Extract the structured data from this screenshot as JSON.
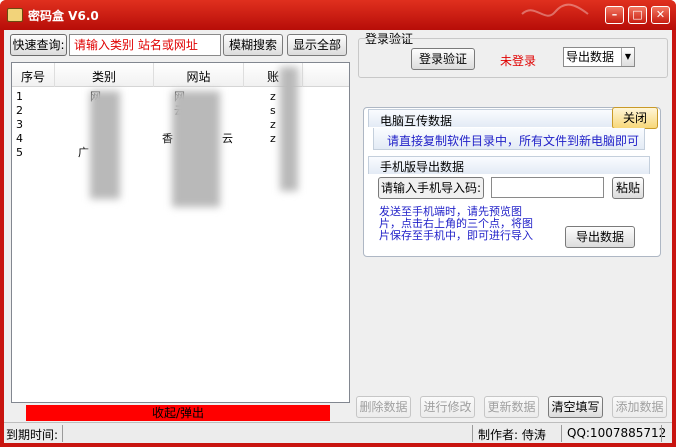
{
  "window": {
    "title": "密码盒 V6.0",
    "min_symbol": "–",
    "max_symbol": "□",
    "close_symbol": "✕"
  },
  "search": {
    "label": "快速查询:",
    "placeholder": "请输入类别 站名或网址",
    "fuzzy_button": "模糊搜索",
    "show_all_button": "显示全部"
  },
  "table": {
    "columns": [
      "序号",
      "类别",
      "网站",
      "账"
    ],
    "rows": [
      {
        "no": "1",
        "cat": "网",
        "site": "网",
        "acc": "z"
      },
      {
        "no": "2",
        "cat": "",
        "site": "云",
        "acc": "s"
      },
      {
        "no": "3",
        "cat": "",
        "site": "",
        "acc": "z"
      },
      {
        "no": "4",
        "cat": "",
        "site": "香",
        "extra": "云",
        "acc": "z"
      },
      {
        "no": "5",
        "cat": "广",
        "site": "",
        "acc": ""
      }
    ]
  },
  "login": {
    "group_title": "登录验证",
    "verify_button": "登录验证",
    "status": "未登录",
    "export_select": "导出数据",
    "status_color": "#e00000"
  },
  "pc_transfer": {
    "title": "电脑互传数据",
    "close_button": "关闭",
    "message": "请直接复制软件目录中，所有文件到新电脑即可"
  },
  "mobile": {
    "title": "手机版导出数据",
    "import_label": "请输入手机导入码:",
    "import_value": "",
    "paste_button": "粘贴",
    "instructions": [
      "发送至手机端时，请先预览图",
      "片，点击右上角的三个点，将图",
      "片保存至手机中，即可进行导入"
    ],
    "export_button": "导出数据"
  },
  "toggle_bar": {
    "label": "收起/弹出",
    "color": "#ff0000"
  },
  "actions": {
    "delete": "删除数据",
    "edit": "进行修改",
    "update": "更新数据",
    "clear": "清空填写",
    "add": "添加数据"
  },
  "status": {
    "expiry_label": "到期时间:",
    "expiry_value": "",
    "author": "制作者: 侍涛",
    "qq": "QQ:1007885712"
  }
}
